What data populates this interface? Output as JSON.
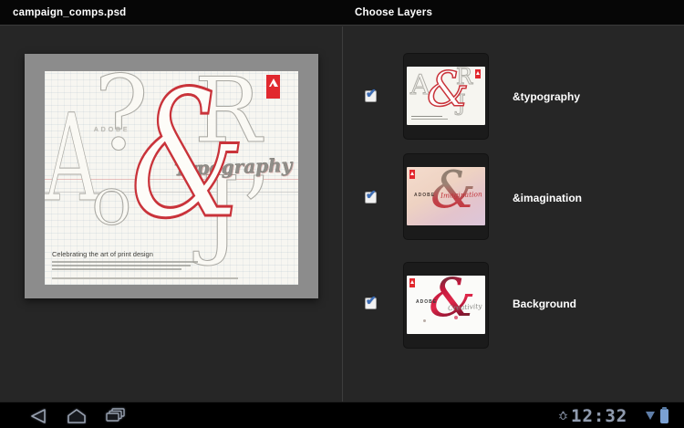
{
  "header_left": {
    "title": "campaign_comps.psd"
  },
  "header_right": {
    "title": "Choose Layers"
  },
  "preview": {
    "letters": {
      "a": "A",
      "question": "?",
      "o": "O",
      "ampersand": "&",
      "r": "R",
      "j": "J’",
      "script": "Typography",
      "adobe_word": "ADOBE"
    },
    "caption_heading": "Celebrating the art of print design"
  },
  "layers": [
    {
      "label": "&typography",
      "checked": true,
      "art": {
        "ampersand": "&",
        "a": "A",
        "r": "R",
        "j": "J"
      }
    },
    {
      "label": "&imagination",
      "checked": true,
      "art": {
        "ampersand": "&",
        "brand": "ADOBE",
        "script": "Imagination"
      }
    },
    {
      "label": "Background",
      "checked": true,
      "art": {
        "ampersand": "&",
        "brand": "ADOBE",
        "script": "Creativity"
      }
    }
  ],
  "system_bar": {
    "clock": "12:32"
  },
  "colors": {
    "adobe_red": "#e1282e",
    "amp_outline_red": "#c9333a",
    "holo_blue_battery": "#7aa0d2",
    "checkbox_check_blue": "#3c6cb4",
    "panel_bg": "#262626",
    "bar_bg": "#060606"
  }
}
